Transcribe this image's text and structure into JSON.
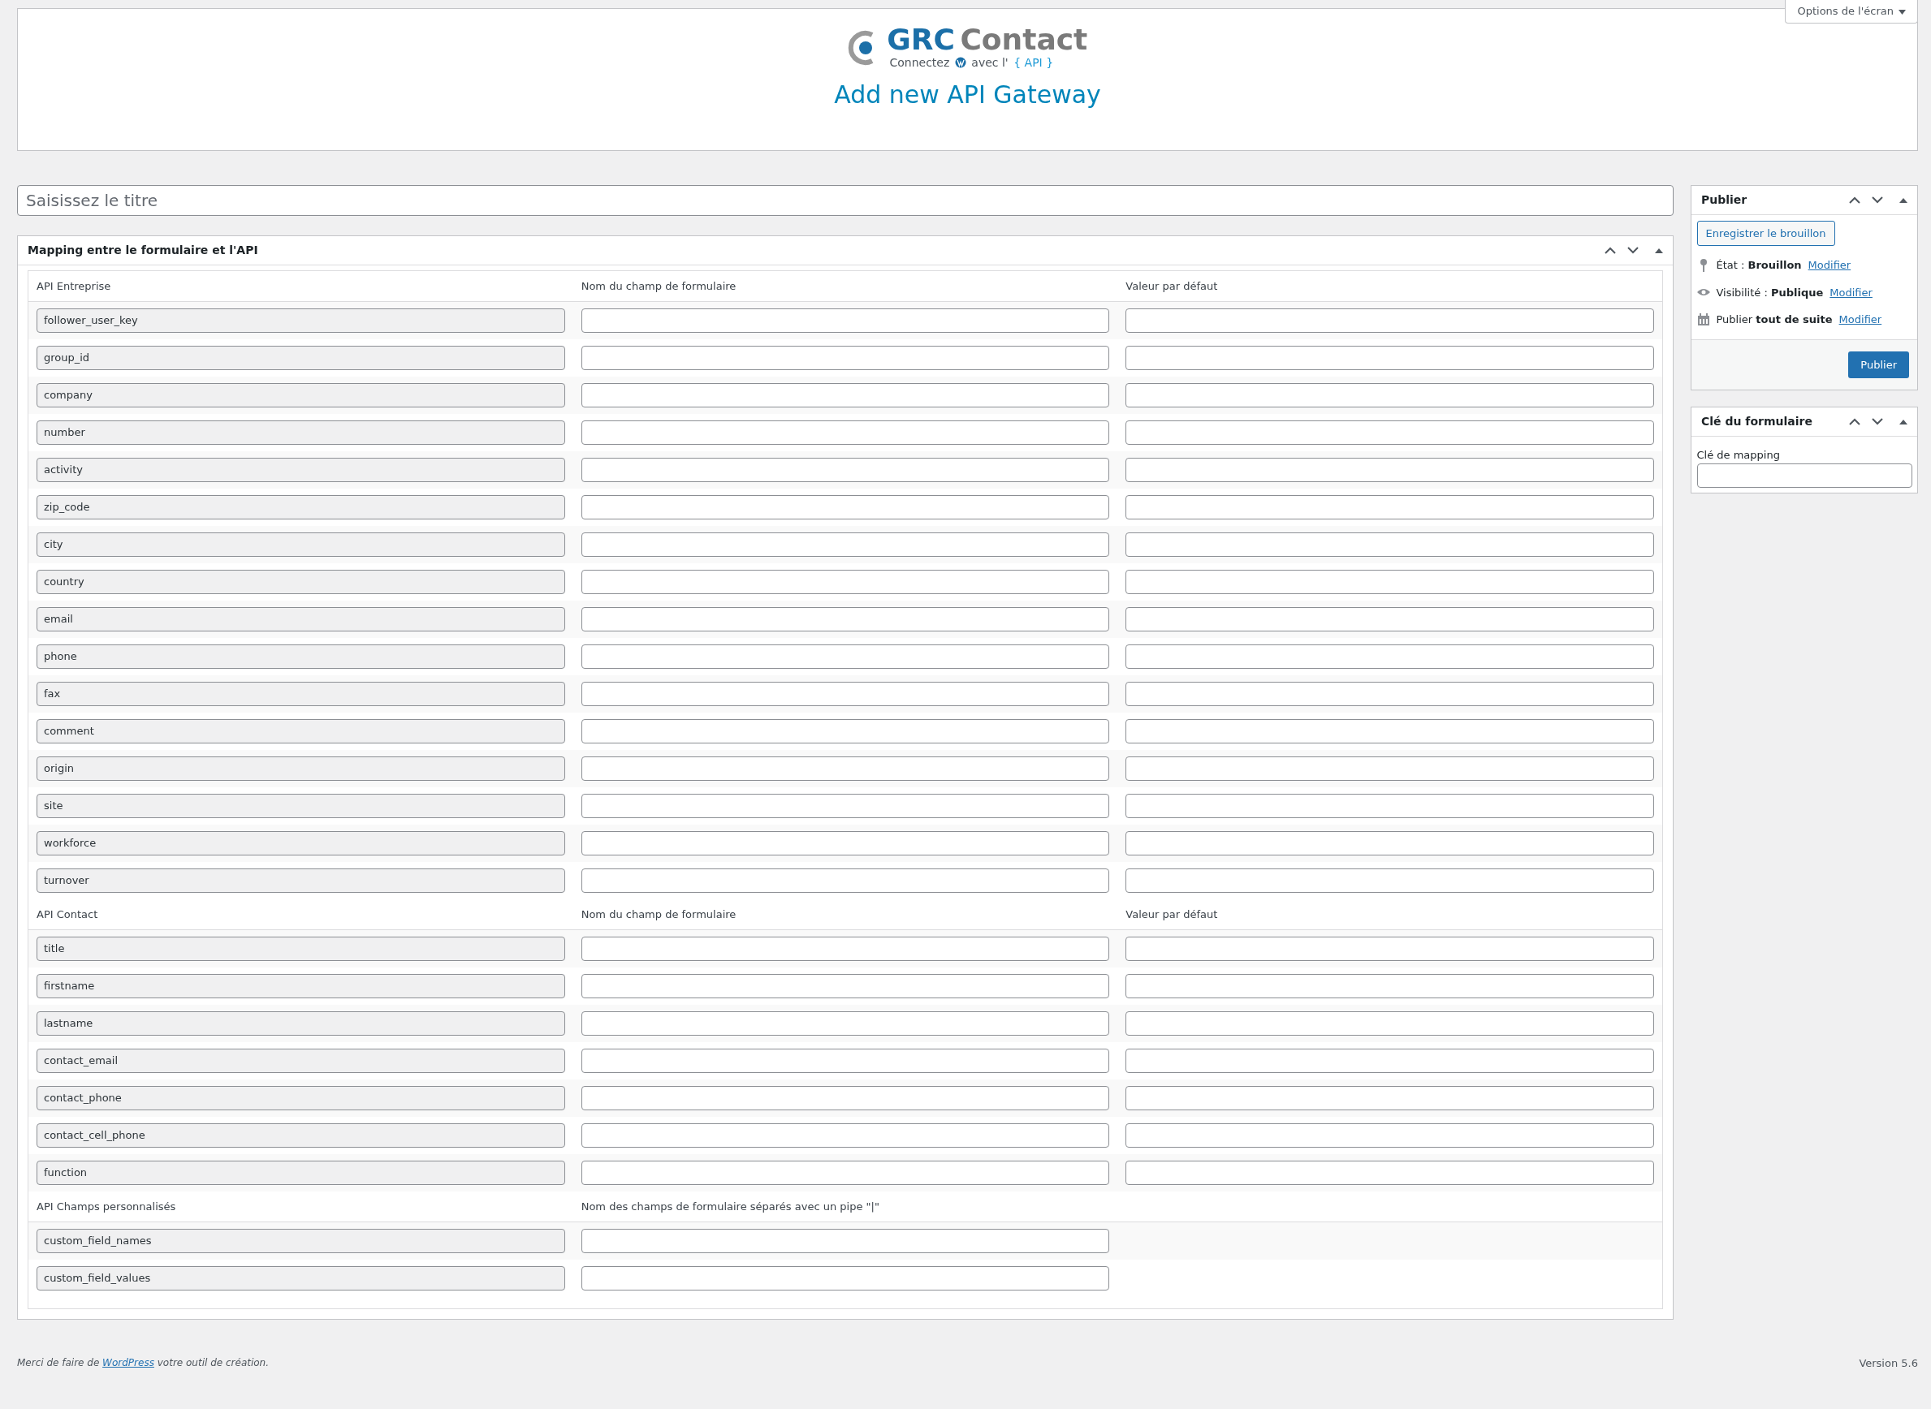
{
  "screen_options": "Options de l'écran",
  "logo": {
    "brand_1": "GRC",
    "brand_2": "Contact",
    "tagline_1": "Connectez",
    "tagline_2": "avec l'",
    "tagline_api": "{ API }"
  },
  "heading": "Add new API Gateway",
  "title_field": {
    "placeholder": "Saisissez le titre"
  },
  "mapping": {
    "title": "Mapping entre le formulaire et l'API",
    "sections": [
      {
        "columns": [
          "API Entreprise",
          "Nom du champ de formulaire",
          "Valeur par défaut"
        ],
        "rows": [
          "follower_user_key",
          "group_id",
          "company",
          "number",
          "activity",
          "zip_code",
          "city",
          "country",
          "email",
          "phone",
          "fax",
          "comment",
          "origin",
          "site",
          "workforce",
          "turnover"
        ]
      },
      {
        "columns": [
          "API Contact",
          "Nom du champ de formulaire",
          "Valeur par défaut"
        ],
        "rows": [
          "title",
          "firstname",
          "lastname",
          "contact_email",
          "contact_phone",
          "contact_cell_phone",
          "function"
        ]
      },
      {
        "columns": [
          "API Champs personnalisés",
          "Nom des champs de formulaire séparés avec un pipe \"|\""
        ],
        "rows": [
          "custom_field_names",
          "custom_field_values"
        ]
      }
    ]
  },
  "publish": {
    "title": "Publier",
    "save_draft": "Enregistrer le brouillon",
    "lines": [
      {
        "kind": "pin",
        "label": "État : ",
        "value": "Brouillon",
        "link": "Modifier"
      },
      {
        "kind": "eye",
        "label": "Visibilité : ",
        "value": "Publique",
        "link": "Modifier"
      },
      {
        "kind": "calendar",
        "label": "Publier ",
        "value": "tout de suite",
        "link": "Modifier"
      }
    ],
    "button": "Publier"
  },
  "form_key": {
    "title": "Clé du formulaire",
    "label": "Clé de mapping"
  },
  "footer": {
    "before": "Merci de faire de ",
    "link": "WordPress",
    "after": " votre outil de création.",
    "version": "Version 5.6"
  }
}
